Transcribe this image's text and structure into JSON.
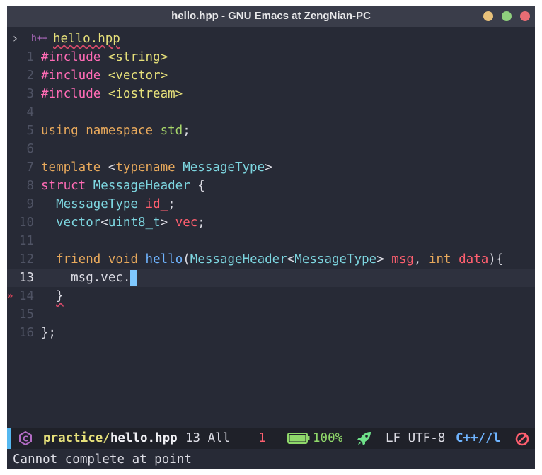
{
  "window": {
    "title": "hello.hpp - GNU Emacs at ZengNian-PC",
    "accent_colors": {
      "minimize": "#e8c17a",
      "maximize": "#8fcf7d",
      "close": "#e86d74"
    }
  },
  "header": {
    "chevron": "›",
    "file_icon": "h++",
    "filename": "hello.hpp"
  },
  "editor": {
    "current_line": 13,
    "lines": [
      {
        "n": "1",
        "tokens": [
          {
            "t": "#include",
            "c": "kw"
          },
          {
            "t": " "
          },
          {
            "t": "<string>",
            "c": "str"
          }
        ]
      },
      {
        "n": "2",
        "tokens": [
          {
            "t": "#include",
            "c": "kw"
          },
          {
            "t": " "
          },
          {
            "t": "<vector>",
            "c": "str"
          }
        ]
      },
      {
        "n": "3",
        "tokens": [
          {
            "t": "#include",
            "c": "kw"
          },
          {
            "t": " "
          },
          {
            "t": "<iostream>",
            "c": "str"
          }
        ]
      },
      {
        "n": "4",
        "tokens": []
      },
      {
        "n": "5",
        "tokens": [
          {
            "t": "using",
            "c": "ty"
          },
          {
            "t": " "
          },
          {
            "t": "namespace",
            "c": "ty"
          },
          {
            "t": " "
          },
          {
            "t": "std",
            "c": "ns"
          },
          {
            "t": ";"
          }
        ]
      },
      {
        "n": "6",
        "tokens": []
      },
      {
        "n": "7",
        "tokens": [
          {
            "t": "template",
            "c": "ty"
          },
          {
            "t": " <"
          },
          {
            "t": "typename",
            "c": "ty"
          },
          {
            "t": " "
          },
          {
            "t": "MessageType",
            "c": "cls"
          },
          {
            "t": ">"
          }
        ]
      },
      {
        "n": "8",
        "tokens": [
          {
            "t": "struct",
            "c": "kw"
          },
          {
            "t": " "
          },
          {
            "t": "MessageHeader",
            "c": "cls"
          },
          {
            "t": " {"
          }
        ]
      },
      {
        "n": "9",
        "tokens": [
          {
            "t": "  "
          },
          {
            "t": "MessageType",
            "c": "cls"
          },
          {
            "t": " "
          },
          {
            "t": "id_",
            "c": "var"
          },
          {
            "t": ";"
          }
        ]
      },
      {
        "n": "10",
        "tokens": [
          {
            "t": "  "
          },
          {
            "t": "vector",
            "c": "cls"
          },
          {
            "t": "<"
          },
          {
            "t": "uint8_t",
            "c": "cls"
          },
          {
            "t": "> "
          },
          {
            "t": "vec",
            "c": "var"
          },
          {
            "t": ";"
          }
        ]
      },
      {
        "n": "11",
        "tokens": []
      },
      {
        "n": "12",
        "tokens": [
          {
            "t": "  "
          },
          {
            "t": "friend",
            "c": "ty"
          },
          {
            "t": " "
          },
          {
            "t": "void",
            "c": "ty"
          },
          {
            "t": " "
          },
          {
            "t": "hello",
            "c": "fn"
          },
          {
            "t": "("
          },
          {
            "t": "MessageHeader",
            "c": "cls"
          },
          {
            "t": "<"
          },
          {
            "t": "MessageType",
            "c": "cls"
          },
          {
            "t": "> "
          },
          {
            "t": "msg",
            "c": "var"
          },
          {
            "t": ", "
          },
          {
            "t": "int",
            "c": "ty"
          },
          {
            "t": " "
          },
          {
            "t": "data",
            "c": "var"
          },
          {
            "t": "){"
          }
        ]
      },
      {
        "n": "13",
        "tokens": [
          {
            "t": "    msg.vec."
          }
        ],
        "cursor": true
      },
      {
        "n": "14",
        "tokens": [
          {
            "t": "  "
          },
          {
            "t": "}",
            "c": "squig"
          }
        ],
        "fringe": "»"
      },
      {
        "n": "15",
        "tokens": []
      },
      {
        "n": "16",
        "tokens": [
          {
            "t": "};"
          }
        ]
      }
    ]
  },
  "modeline": {
    "project": "practice/",
    "file": "hello.hpp",
    "position": "13 All",
    "errors": "1",
    "battery": "100%",
    "battery_level": 1.0,
    "encoding": "LF UTF-8",
    "mode": "C++//l"
  },
  "echo_area": {
    "message": "Cannot complete at point"
  }
}
